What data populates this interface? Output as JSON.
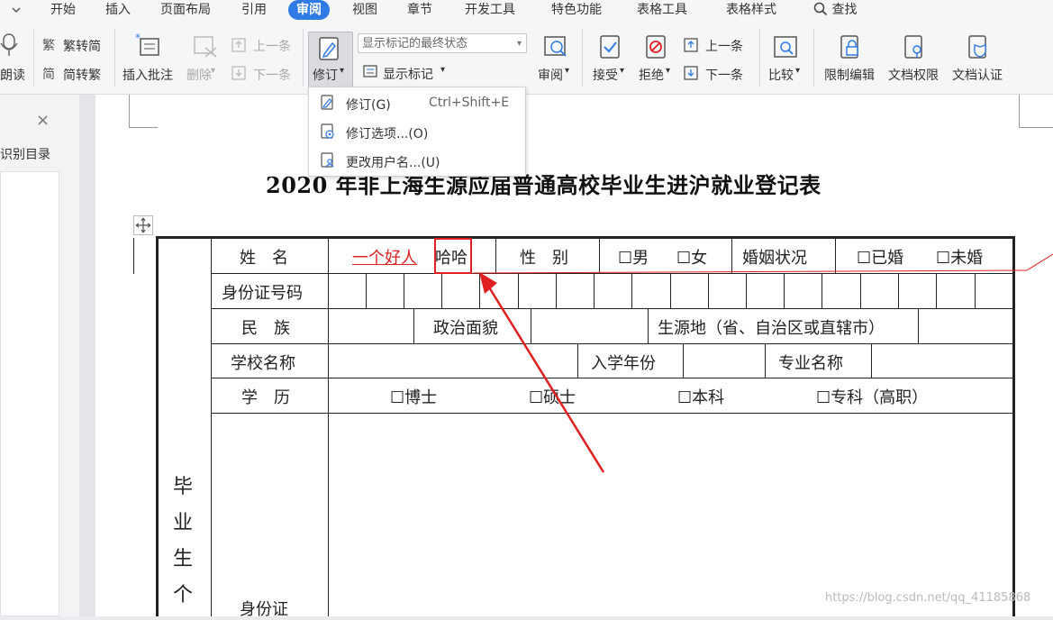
{
  "tabs": {
    "dropdown_icon": "chevron-down-icon",
    "items": [
      "开始",
      "插入",
      "页面布局",
      "引用",
      "审阅",
      "视图",
      "章节",
      "开发工具",
      "特色功能",
      "表格工具",
      "表格样式"
    ],
    "active": "审阅",
    "search": "查找"
  },
  "ribbon": {
    "read_aloud": "朗读",
    "trad_to_simp": "繁转简",
    "simp_to_trad": "简转繁",
    "insert_comment": "插入批注",
    "delete": "删除",
    "prev_comment": "上一条",
    "next_comment": "下一条",
    "track_changes": "修订",
    "markup_state": "显示标记的最终状态",
    "show_markup": "显示标记",
    "review": "审阅",
    "accept": "接受",
    "reject": "拒绝",
    "prev_change": "上一条",
    "next_change": "下一条",
    "compare": "比较",
    "restrict_edit": "限制编辑",
    "doc_permission": "文档权限",
    "doc_cert": "文档认证"
  },
  "left_panel": {
    "title": "识别目录",
    "close": "×"
  },
  "dropdown": {
    "items": [
      {
        "label": "修订(G)",
        "shortcut": "Ctrl+Shift+E"
      },
      {
        "label": "修订选项...(O)",
        "shortcut": ""
      },
      {
        "label": "更改用户名...(U)",
        "shortcut": ""
      }
    ]
  },
  "document": {
    "title": "2020 年非上海生源应届普通高校毕业生进沪就业登记表",
    "row1": {
      "name_label": "姓　名",
      "name_inserted": "一个好人",
      "name_rest": "哈哈",
      "gender_label": "性　别",
      "male": "☐男",
      "female": "☐女",
      "marital_label": "婚姻状况",
      "married": "☐已婚",
      "unmarried": "☐未婚"
    },
    "id_label": "身份证号码",
    "row3": {
      "ethnic_label": "民　族",
      "political_label": "政治面貌",
      "origin_label": "生源地（省、自治区或直辖市）"
    },
    "row4": {
      "school_label": "学校名称",
      "year_label": "入学年份",
      "major_label": "专业名称"
    },
    "row5": {
      "edu_label": "学　历",
      "phd": "☐博士",
      "master": "☐硕士",
      "bachelor": "☐本科",
      "college": "☐专科（高职）"
    },
    "side_label": [
      "毕",
      "业",
      "生",
      "个"
    ],
    "id_bottom_label": "身份证",
    "inserted_color": "#e02020",
    "highlight_color": "#e02020"
  },
  "watermark": "https://blog.csdn.net/qq_41185868"
}
